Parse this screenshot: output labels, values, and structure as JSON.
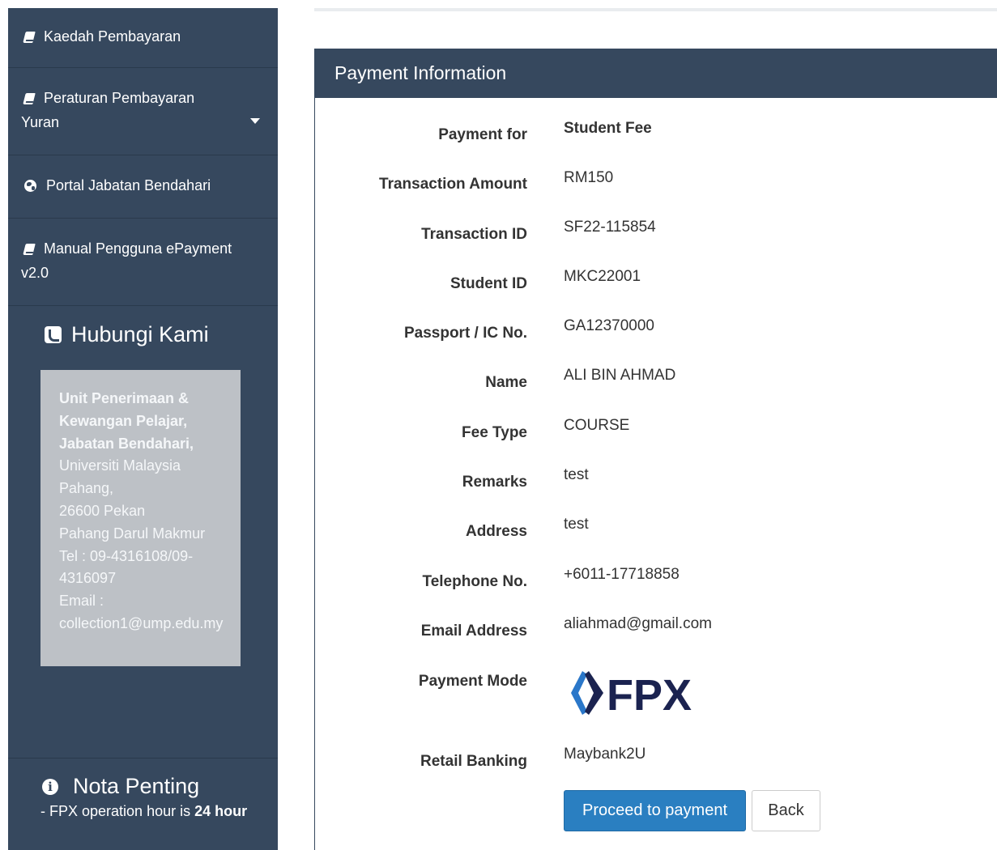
{
  "sidebar": {
    "items": [
      {
        "label": "Kaedah Pembayaran",
        "icon": "book-icon"
      },
      {
        "label_line1": "Peraturan Pembayaran",
        "label_line2": "Yuran",
        "icon": "book-icon"
      },
      {
        "label": "Portal Jabatan Bendahari",
        "icon": "globe-icon"
      },
      {
        "label_line1": "Manual Pengguna ePayment",
        "label_line2": "v2.0",
        "icon": "book-icon"
      }
    ],
    "contact": {
      "title": "Hubungi Kami",
      "lines_bold": [
        "Unit Penerimaan &",
        "Kewangan Pelajar,",
        "Jabatan Bendahari,"
      ],
      "lines": [
        "Universiti Malaysia",
        "Pahang,",
        "26600 Pekan",
        "Pahang Darul Makmur",
        "Tel : 09-4316108/09-",
        "4316097",
        "Email :",
        "collection1@ump.edu.my"
      ]
    },
    "nota": {
      "title": "Nota Penting",
      "text_prefix": "- FPX operation hour is ",
      "text_bold": "24 hour"
    }
  },
  "panel": {
    "title": "Payment Information",
    "rows": [
      {
        "label": "Payment for",
        "value": "Student Fee"
      },
      {
        "label": "Transaction Amount",
        "value": "RM150"
      },
      {
        "label": "Transaction ID",
        "value": "SF22-115854"
      },
      {
        "label": "Student ID",
        "value": "MKC22001"
      },
      {
        "label": "Passport / IC No.",
        "value": "GA12370000"
      },
      {
        "label": "Name",
        "value": "ALI BIN AHMAD"
      },
      {
        "label": "Fee Type",
        "value": "COURSE"
      },
      {
        "label": "Remarks",
        "value": "test"
      },
      {
        "label": "Address",
        "value": "test"
      },
      {
        "label": "Telephone No.",
        "value": "+6011-17718858"
      },
      {
        "label": "Email Address",
        "value": "aliahmad@gmail.com"
      }
    ],
    "payment_mode": {
      "label": "Payment Mode",
      "logo_text": "FPX"
    },
    "retail_banking": {
      "label": "Retail Banking",
      "value": "Maybank2U"
    },
    "buttons": {
      "proceed": "Proceed to payment",
      "back": "Back"
    }
  },
  "colors": {
    "sidebar_bg": "#36485e",
    "contact_box": "#bdc1c6",
    "primary_button": "#2a7fc1",
    "fpx_navy": "#1b2350"
  }
}
